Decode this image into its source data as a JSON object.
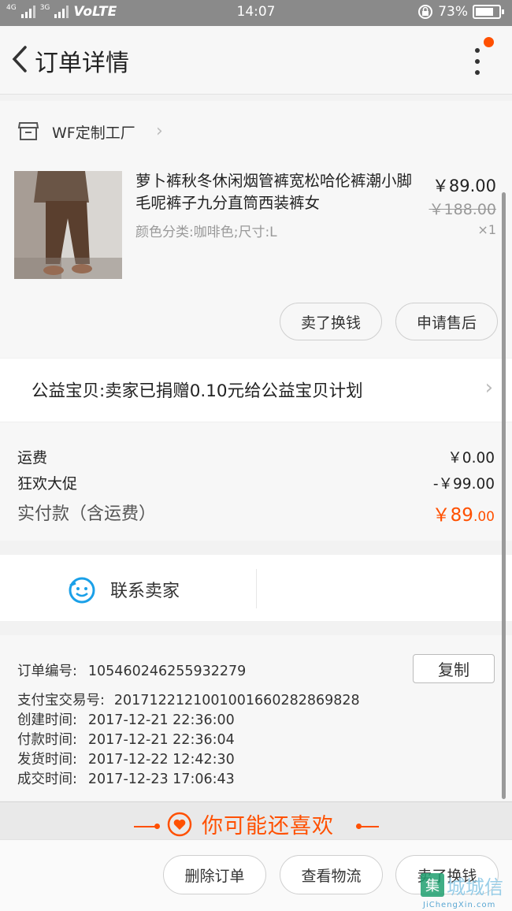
{
  "status_bar": {
    "network_4g": "4G",
    "network_3g": "3G",
    "volte": "VoLTE",
    "time": "14:07",
    "battery": "73%"
  },
  "nav": {
    "title": "订单详情"
  },
  "shop": {
    "name": "WF定制工厂"
  },
  "product": {
    "title": "萝卜裤秋冬休闲烟管裤宽松哈伦裤潮小脚毛呢裤子九分直筒西装裤女",
    "spec": "颜色分类:咖啡色;尺寸:L",
    "price": "￥89.00",
    "original_price": "￥188.00",
    "quantity": "×1",
    "buttons": {
      "sell": "卖了换钱",
      "after_sale": "申请售后"
    }
  },
  "charity": {
    "text": "公益宝贝:卖家已捐赠0.10元给公益宝贝计划"
  },
  "fees": {
    "shipping_label": "运费",
    "shipping_value": "￥0.00",
    "promo_label": "狂欢大促",
    "promo_value": "-￥99.00",
    "total_label": "实付款（含运费）",
    "total_currency_int": "￥89",
    "total_decimal": ".00"
  },
  "contact": {
    "label": "联系卖家"
  },
  "order_info": {
    "order_no_label": "订单编号:",
    "order_no": "105460246255932279",
    "copy_label": "复制",
    "alipay_label": "支付宝交易号:",
    "alipay_no": "2017122121001001660282869828",
    "created_label": "创建时间:",
    "created": "2017-12-21 22:36:00",
    "paid_label": "付款时间:",
    "paid": "2017-12-21 22:36:04",
    "shipped_label": "发货时间:",
    "shipped": "2017-12-22 12:42:30",
    "done_label": "成交时间:",
    "done": "2017-12-23 17:06:43"
  },
  "recommend": {
    "title": "你可能还喜欢"
  },
  "bottom_bar": {
    "delete": "删除订单",
    "logistics": "查看物流",
    "sell": "卖了换钱"
  },
  "watermark": {
    "logo_char": "集",
    "text": "城城信",
    "sub": "JiChengXin.com"
  },
  "colors": {
    "accent": "#ff5000",
    "contact_icon": "#1aa0e8"
  }
}
